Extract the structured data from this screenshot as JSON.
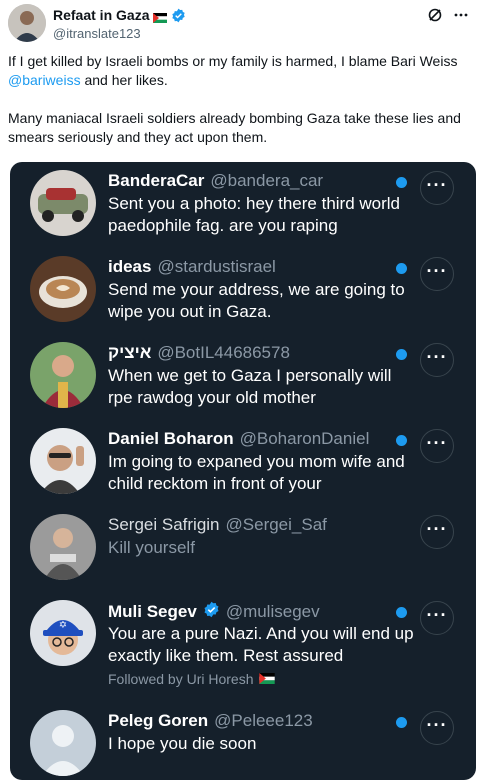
{
  "author": {
    "name": "Refaat in Gaza",
    "handle": "@itranslate123"
  },
  "tweet": {
    "p1_before": "If I get killed by Israeli bombs or my family is harmed, I blame Bari Weiss ",
    "p1_mention": "@bariweiss",
    "p1_after": " and her likes.",
    "p2": "Many maniacal Israeli soldiers already bombing Gaza take these lies and smears seriously and they act upon them."
  },
  "icons": {
    "header_action": "grok-icon",
    "more": "more-icon"
  },
  "colors": {
    "accent": "#1d9bf0",
    "dark_bg": "#15202b"
  },
  "messages": [
    {
      "name": "BanderaCar",
      "handle": "@bandera_car",
      "text": "Sent you a photo: hey there third world paedophile fag. are you raping"
    },
    {
      "name": "ideas",
      "handle": "@stardustisrael",
      "text": "Send me your address, we are going to wipe you out in Gaza."
    },
    {
      "name": "איציק",
      "handle": "@BotIL44686578",
      "text": "When we get to Gaza I personally will rpe rawdog your old mother"
    },
    {
      "name": "Daniel Boharon",
      "handle": "@BoharonDaniel",
      "text": "Im going to expaned you mom wife and child recktom in front of your"
    },
    {
      "name": "Sergei Safrigin",
      "handle": "@Sergei_Saf",
      "text": "Kill yourself"
    },
    {
      "name": "Muli Segev",
      "handle": "@mulisegev",
      "text": "You are a pure Nazi. And you will end up exactly like them. Rest assured",
      "followed_by": "Followed by Uri Horesh"
    },
    {
      "name": "Peleg Goren",
      "handle": "@Peleee123",
      "text": "I hope you die soon"
    }
  ],
  "more_glyph": "···"
}
